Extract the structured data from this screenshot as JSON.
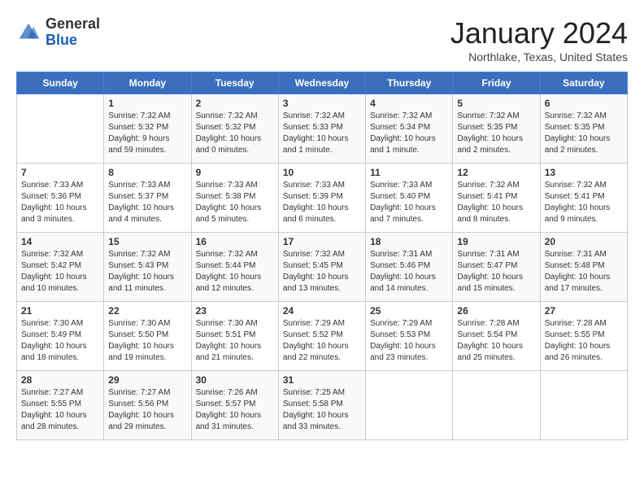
{
  "logo": {
    "general": "General",
    "blue": "Blue"
  },
  "title": "January 2024",
  "location": "Northlake, Texas, United States",
  "days_header": [
    "Sunday",
    "Monday",
    "Tuesday",
    "Wednesday",
    "Thursday",
    "Friday",
    "Saturday"
  ],
  "weeks": [
    [
      {
        "day": "",
        "info": ""
      },
      {
        "day": "1",
        "info": "Sunrise: 7:32 AM\nSunset: 5:32 PM\nDaylight: 9 hours\nand 59 minutes."
      },
      {
        "day": "2",
        "info": "Sunrise: 7:32 AM\nSunset: 5:32 PM\nDaylight: 10 hours\nand 0 minutes."
      },
      {
        "day": "3",
        "info": "Sunrise: 7:32 AM\nSunset: 5:33 PM\nDaylight: 10 hours\nand 1 minute."
      },
      {
        "day": "4",
        "info": "Sunrise: 7:32 AM\nSunset: 5:34 PM\nDaylight: 10 hours\nand 1 minute."
      },
      {
        "day": "5",
        "info": "Sunrise: 7:32 AM\nSunset: 5:35 PM\nDaylight: 10 hours\nand 2 minutes."
      },
      {
        "day": "6",
        "info": "Sunrise: 7:32 AM\nSunset: 5:35 PM\nDaylight: 10 hours\nand 2 minutes."
      }
    ],
    [
      {
        "day": "7",
        "info": "Sunrise: 7:33 AM\nSunset: 5:36 PM\nDaylight: 10 hours\nand 3 minutes."
      },
      {
        "day": "8",
        "info": "Sunrise: 7:33 AM\nSunset: 5:37 PM\nDaylight: 10 hours\nand 4 minutes."
      },
      {
        "day": "9",
        "info": "Sunrise: 7:33 AM\nSunset: 5:38 PM\nDaylight: 10 hours\nand 5 minutes."
      },
      {
        "day": "10",
        "info": "Sunrise: 7:33 AM\nSunset: 5:39 PM\nDaylight: 10 hours\nand 6 minutes."
      },
      {
        "day": "11",
        "info": "Sunrise: 7:33 AM\nSunset: 5:40 PM\nDaylight: 10 hours\nand 7 minutes."
      },
      {
        "day": "12",
        "info": "Sunrise: 7:32 AM\nSunset: 5:41 PM\nDaylight: 10 hours\nand 8 minutes."
      },
      {
        "day": "13",
        "info": "Sunrise: 7:32 AM\nSunset: 5:41 PM\nDaylight: 10 hours\nand 9 minutes."
      }
    ],
    [
      {
        "day": "14",
        "info": "Sunrise: 7:32 AM\nSunset: 5:42 PM\nDaylight: 10 hours\nand 10 minutes."
      },
      {
        "day": "15",
        "info": "Sunrise: 7:32 AM\nSunset: 5:43 PM\nDaylight: 10 hours\nand 11 minutes."
      },
      {
        "day": "16",
        "info": "Sunrise: 7:32 AM\nSunset: 5:44 PM\nDaylight: 10 hours\nand 12 minutes."
      },
      {
        "day": "17",
        "info": "Sunrise: 7:32 AM\nSunset: 5:45 PM\nDaylight: 10 hours\nand 13 minutes."
      },
      {
        "day": "18",
        "info": "Sunrise: 7:31 AM\nSunset: 5:46 PM\nDaylight: 10 hours\nand 14 minutes."
      },
      {
        "day": "19",
        "info": "Sunrise: 7:31 AM\nSunset: 5:47 PM\nDaylight: 10 hours\nand 15 minutes."
      },
      {
        "day": "20",
        "info": "Sunrise: 7:31 AM\nSunset: 5:48 PM\nDaylight: 10 hours\nand 17 minutes."
      }
    ],
    [
      {
        "day": "21",
        "info": "Sunrise: 7:30 AM\nSunset: 5:49 PM\nDaylight: 10 hours\nand 18 minutes."
      },
      {
        "day": "22",
        "info": "Sunrise: 7:30 AM\nSunset: 5:50 PM\nDaylight: 10 hours\nand 19 minutes."
      },
      {
        "day": "23",
        "info": "Sunrise: 7:30 AM\nSunset: 5:51 PM\nDaylight: 10 hours\nand 21 minutes."
      },
      {
        "day": "24",
        "info": "Sunrise: 7:29 AM\nSunset: 5:52 PM\nDaylight: 10 hours\nand 22 minutes."
      },
      {
        "day": "25",
        "info": "Sunrise: 7:29 AM\nSunset: 5:53 PM\nDaylight: 10 hours\nand 23 minutes."
      },
      {
        "day": "26",
        "info": "Sunrise: 7:28 AM\nSunset: 5:54 PM\nDaylight: 10 hours\nand 25 minutes."
      },
      {
        "day": "27",
        "info": "Sunrise: 7:28 AM\nSunset: 5:55 PM\nDaylight: 10 hours\nand 26 minutes."
      }
    ],
    [
      {
        "day": "28",
        "info": "Sunrise: 7:27 AM\nSunset: 5:55 PM\nDaylight: 10 hours\nand 28 minutes."
      },
      {
        "day": "29",
        "info": "Sunrise: 7:27 AM\nSunset: 5:56 PM\nDaylight: 10 hours\nand 29 minutes."
      },
      {
        "day": "30",
        "info": "Sunrise: 7:26 AM\nSunset: 5:57 PM\nDaylight: 10 hours\nand 31 minutes."
      },
      {
        "day": "31",
        "info": "Sunrise: 7:25 AM\nSunset: 5:58 PM\nDaylight: 10 hours\nand 33 minutes."
      },
      {
        "day": "",
        "info": ""
      },
      {
        "day": "",
        "info": ""
      },
      {
        "day": "",
        "info": ""
      }
    ]
  ]
}
